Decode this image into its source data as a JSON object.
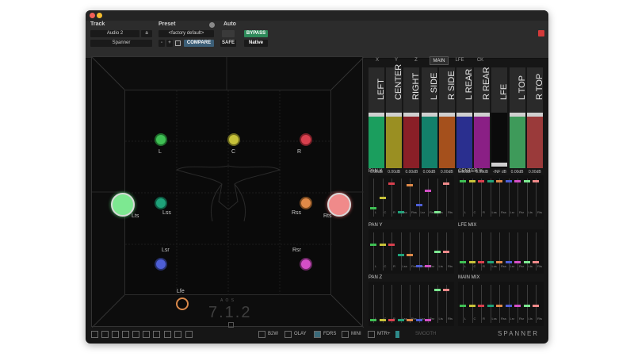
{
  "header": {
    "track_label": "Track",
    "preset_label": "Preset",
    "auto_label": "Auto",
    "track_value": "Audio 2",
    "track_suffix": "a",
    "plugin_value": "Spanner",
    "preset_value": "<factory default>",
    "compare_label": "COMPARE",
    "safe_label": "SAFE",
    "bypass_label": "BYPASS",
    "native_label": "Native"
  },
  "stage": {
    "format": "7.1.2",
    "format_caption": "A O S",
    "speakers": [
      {
        "name": "L",
        "color": "#3fbf54"
      },
      {
        "name": "C",
        "color": "#c7c23a"
      },
      {
        "name": "R",
        "color": "#d8404e"
      },
      {
        "name": "Lts",
        "color": "#7de891"
      },
      {
        "name": "Lss",
        "color": "#1fa37a"
      },
      {
        "name": "Rss",
        "color": "#e08a48"
      },
      {
        "name": "Rts",
        "color": "#f08a8a"
      },
      {
        "name": "Lsr",
        "color": "#4e5fd6"
      },
      {
        "name": "Rsr",
        "color": "#d44fc6"
      },
      {
        "name": "Lfe",
        "color": "#d9884a"
      }
    ]
  },
  "bottom": {
    "b2w": "B2W",
    "olay": "OLAY",
    "fdrs": "FDRS",
    "mini": "MINI",
    "mtr": "MTR+",
    "smooth": "SMOOTH",
    "brand": "SPANNER"
  },
  "tabs": [
    "X",
    "Y",
    "Z",
    "MAIN",
    "LFE",
    "CK"
  ],
  "meters": [
    {
      "name": "LEFT",
      "color": "#1b9e5e",
      "value": "0.00dB"
    },
    {
      "name": "CENTER",
      "color": "#9a8f22",
      "value": "0.00dB"
    },
    {
      "name": "RIGHT",
      "color": "#8a1f27",
      "value": "0.00dB"
    },
    {
      "name": "L SIDE",
      "color": "#13806a",
      "value": "0.00dB"
    },
    {
      "name": "R SIDE",
      "color": "#a5501c",
      "value": "0.00dB"
    },
    {
      "name": "L REAR",
      "color": "#2a2f8f",
      "value": "0.00dB"
    },
    {
      "name": "R REAR",
      "color": "#8a1f85",
      "value": "0.00dB"
    },
    {
      "name": "LFE",
      "color": "#b0b0b0",
      "value": "-INF dB"
    },
    {
      "name": "L TOP",
      "color": "#3e9a5a",
      "value": "0.00dB"
    },
    {
      "name": "R TOP",
      "color": "#9a3a3a",
      "value": "0.00dB"
    }
  ],
  "sections": {
    "pan_x": "PAN X",
    "center_pct": "CENTER %",
    "pan_y": "PAN Y",
    "lfe_mix": "LFE MIX",
    "pan_z": "PAN Z",
    "main_mix": "MAIN MIX"
  },
  "fader_labels": [
    "L",
    "C",
    "R",
    "Lss",
    "Rss",
    "Lsr",
    "Rsr",
    "Lts",
    "Rts"
  ]
}
